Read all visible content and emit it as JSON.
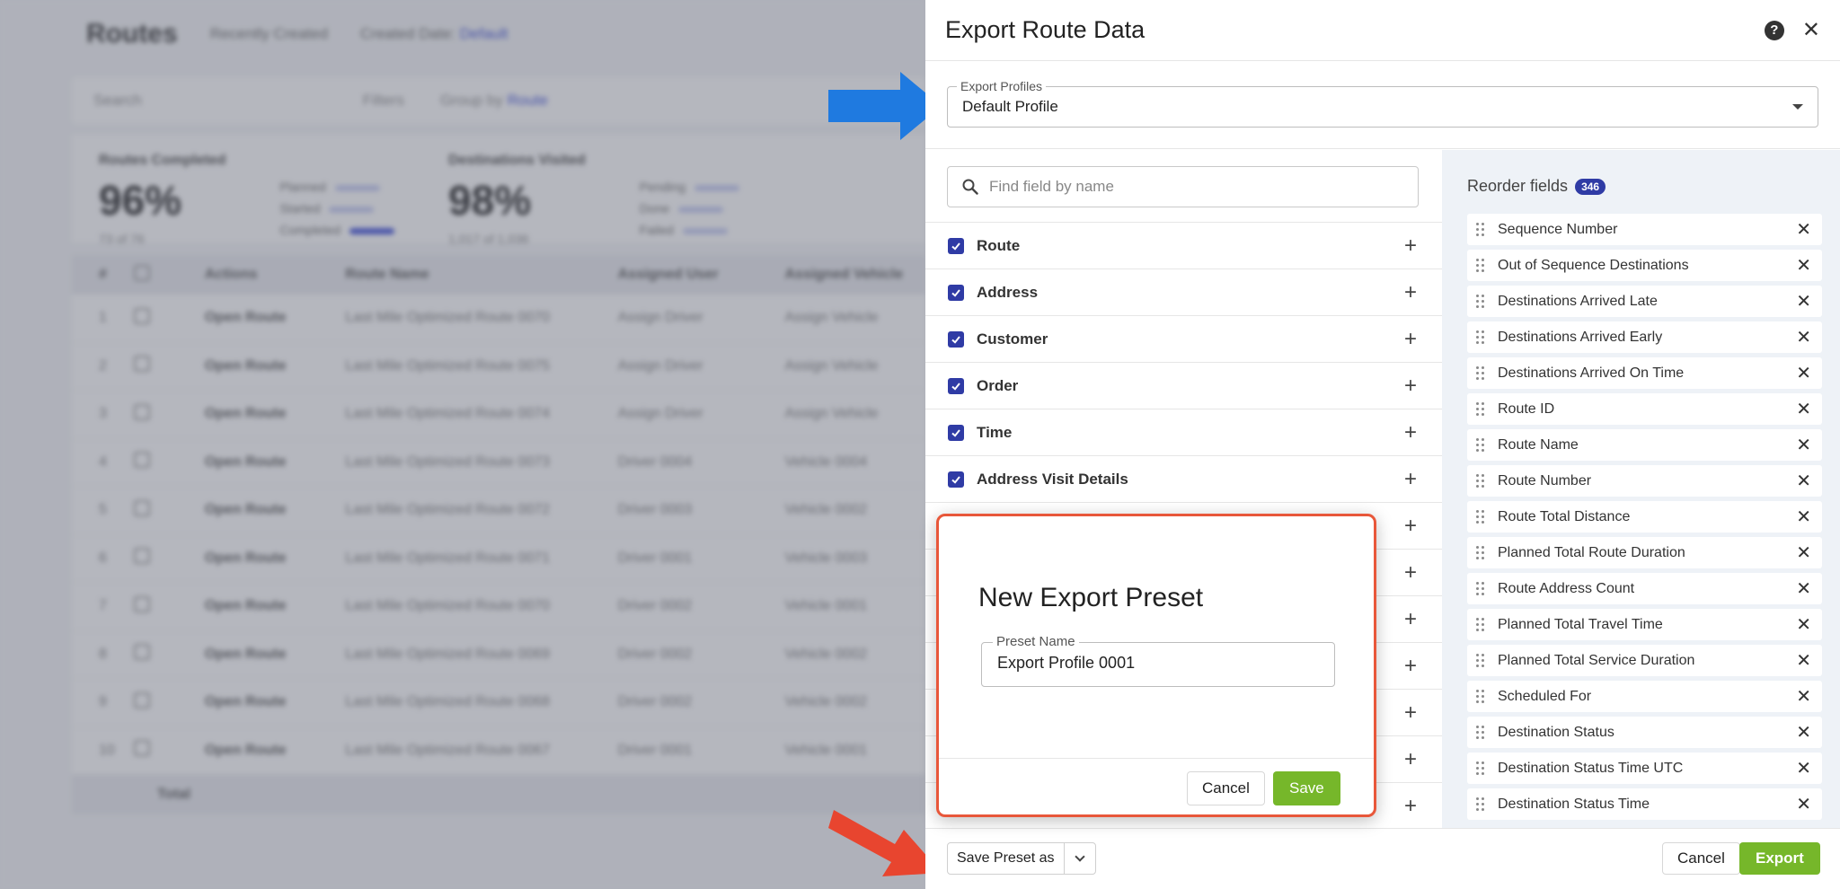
{
  "background": {
    "page_title": "Routes",
    "sort_label": "Recently Created",
    "created_date_label": "Created Date:",
    "created_date_value": "Default",
    "search_placeholder": "Search",
    "filters_label": "Filters",
    "group_by_label": "Group by",
    "group_by_value": "Route",
    "stats": [
      {
        "label": "Routes Completed",
        "value": "96%",
        "sub": "73 of 76",
        "rows": [
          "Planned",
          "Started",
          "Completed"
        ]
      },
      {
        "label": "Destinations Visited",
        "value": "98%",
        "sub": "1,017 of 1,036",
        "rows": [
          "Pending",
          "Done",
          "Failed"
        ]
      }
    ],
    "table_headers": [
      "#",
      "",
      "Actions",
      "Route Name",
      "Assigned User",
      "Assigned Vehicle"
    ],
    "rows": [
      {
        "num": "1",
        "action": "Open Route",
        "name": "Last Mile Optimized Route 0070",
        "user": "Assign Driver",
        "vehicle": "Assign Vehicle"
      },
      {
        "num": "2",
        "action": "Open Route",
        "name": "Last Mile Optimized Route 0075",
        "user": "Assign Driver",
        "vehicle": "Assign Vehicle"
      },
      {
        "num": "3",
        "action": "Open Route",
        "name": "Last Mile Optimized Route 0074",
        "user": "Assign Driver",
        "vehicle": "Assign Vehicle"
      },
      {
        "num": "4",
        "action": "Open Route",
        "name": "Last Mile Optimized Route 0073",
        "user": "Driver 0004",
        "vehicle": "Vehicle 0004"
      },
      {
        "num": "5",
        "action": "Open Route",
        "name": "Last Mile Optimized Route 0072",
        "user": "Driver 0003",
        "vehicle": "Vehicle 0002"
      },
      {
        "num": "6",
        "action": "Open Route",
        "name": "Last Mile Optimized Route 0071",
        "user": "Driver 0001",
        "vehicle": "Vehicle 0003"
      },
      {
        "num": "7",
        "action": "Open Route",
        "name": "Last Mile Optimized Route 0070",
        "user": "Driver 0002",
        "vehicle": "Vehicle 0001"
      },
      {
        "num": "8",
        "action": "Open Route",
        "name": "Last Mile Optimized Route 0069",
        "user": "Driver 0002",
        "vehicle": "Vehicle 0002"
      },
      {
        "num": "9",
        "action": "Open Route",
        "name": "Last Mile Optimized Route 0068",
        "user": "Driver 0002",
        "vehicle": "Vehicle 0002"
      },
      {
        "num": "10",
        "action": "Open Route",
        "name": "Last Mile Optimized Route 0067",
        "user": "Driver 0001",
        "vehicle": "Vehicle 0001"
      }
    ],
    "total_label": "Total"
  },
  "drawer": {
    "title": "Export Route Data",
    "help_glyph": "?",
    "close_glyph": "✕",
    "export_profiles": {
      "legend": "Export Profiles",
      "value": "Default Profile"
    },
    "search_placeholder": "Find field by name",
    "field_groups": [
      {
        "label": "Route",
        "checked": true
      },
      {
        "label": "Address",
        "checked": true
      },
      {
        "label": "Customer",
        "checked": true
      },
      {
        "label": "Order",
        "checked": true
      },
      {
        "label": "Time",
        "checked": true
      },
      {
        "label": "Address Visit Details",
        "checked": true
      },
      {
        "label": "",
        "checked": false
      },
      {
        "label": "",
        "checked": false
      },
      {
        "label": "",
        "checked": false
      },
      {
        "label": "",
        "checked": false
      },
      {
        "label": "",
        "checked": false
      },
      {
        "label": "",
        "checked": false
      },
      {
        "label": "",
        "checked": false
      }
    ],
    "plus_glyph": "+",
    "reorder": {
      "title": "Reorder fields",
      "count": "346",
      "remove_glyph": "✕",
      "items": [
        "Sequence Number",
        "Out of Sequence Destinations",
        "Destinations Arrived Late",
        "Destinations Arrived Early",
        "Destinations Arrived On Time",
        "Route ID",
        "Route Name",
        "Route Number",
        "Route Total Distance",
        "Planned Total Route Duration",
        "Route Address Count",
        "Planned Total Travel Time",
        "Planned Total Service Duration",
        "Scheduled For",
        "Destination Status",
        "Destination Status Time UTC",
        "Destination Status Time"
      ]
    },
    "footer": {
      "save_preset_label": "Save Preset as",
      "cancel_label": "Cancel",
      "export_label": "Export"
    }
  },
  "preset_modal": {
    "title": "New Export Preset",
    "field_legend": "Preset Name",
    "field_value": "Export Profile 0001",
    "cancel_label": "Cancel",
    "save_label": "Save"
  },
  "colors": {
    "accent_blue": "#2f3ba5",
    "save_green": "#76b72a",
    "highlight_red": "#e8573a",
    "arrow_blue": "#1f7ae0",
    "arrow_red": "#e8452f"
  },
  "icons": {
    "search": "search-icon",
    "help": "help-icon",
    "close": "close-icon",
    "plus": "plus-icon",
    "drag": "drag-handle-icon",
    "remove": "remove-icon",
    "caret": "caret-down-icon",
    "chevron": "chevron-down-icon"
  }
}
